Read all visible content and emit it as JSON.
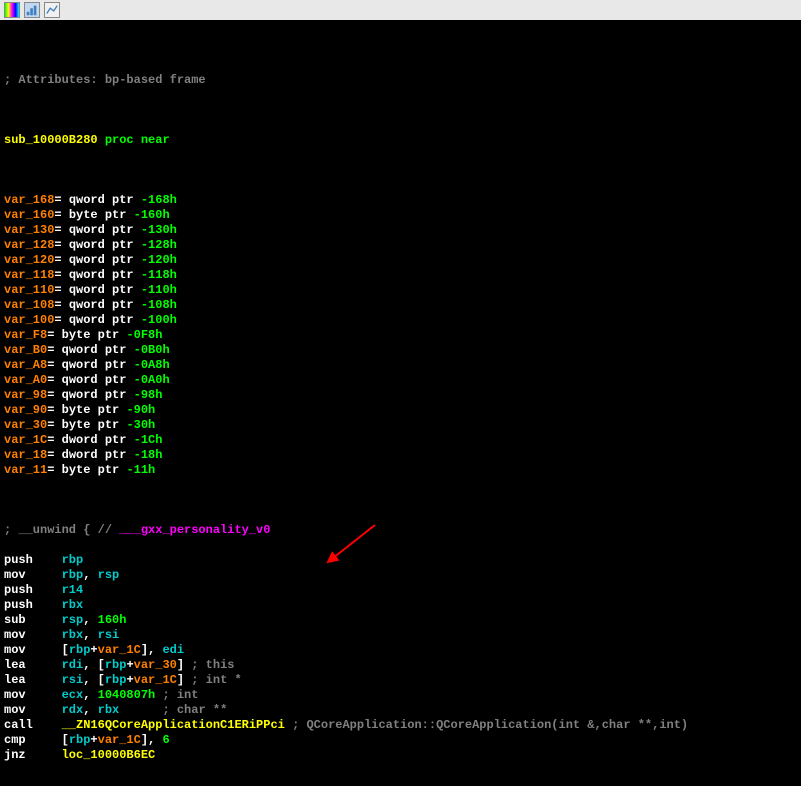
{
  "toolbar": {
    "icon1": "bars-icon",
    "icon2": "chart-icon",
    "icon3": "graph-icon"
  },
  "header": {
    "attributes_comment": "; Attributes: bp-based frame",
    "func_name": "sub_10000B280",
    "proc": "proc",
    "near": "near"
  },
  "vars": [
    {
      "name": "var_168",
      "eq": "=",
      "type": "qword ptr",
      "offset": "-168h"
    },
    {
      "name": "var_160",
      "eq": "=",
      "type": "byte ptr",
      "offset": "-160h"
    },
    {
      "name": "var_130",
      "eq": "=",
      "type": "qword ptr",
      "offset": "-130h"
    },
    {
      "name": "var_128",
      "eq": "=",
      "type": "qword ptr",
      "offset": "-128h"
    },
    {
      "name": "var_120",
      "eq": "=",
      "type": "qword ptr",
      "offset": "-120h"
    },
    {
      "name": "var_118",
      "eq": "=",
      "type": "qword ptr",
      "offset": "-118h"
    },
    {
      "name": "var_110",
      "eq": "=",
      "type": "qword ptr",
      "offset": "-110h"
    },
    {
      "name": "var_108",
      "eq": "=",
      "type": "qword ptr",
      "offset": "-108h"
    },
    {
      "name": "var_100",
      "eq": "=",
      "type": "qword ptr",
      "offset": "-100h"
    },
    {
      "name": "var_F8",
      "eq": "=",
      "type": "byte ptr",
      "offset": "-0F8h"
    },
    {
      "name": "var_B0",
      "eq": "=",
      "type": "qword ptr",
      "offset": "-0B0h"
    },
    {
      "name": "var_A8",
      "eq": "=",
      "type": "qword ptr",
      "offset": "-0A8h"
    },
    {
      "name": "var_A0",
      "eq": "=",
      "type": "qword ptr",
      "offset": "-0A0h"
    },
    {
      "name": "var_98",
      "eq": "=",
      "type": "qword ptr",
      "offset": "-98h"
    },
    {
      "name": "var_90",
      "eq": "=",
      "type": "byte ptr",
      "offset": "-90h"
    },
    {
      "name": "var_30",
      "eq": "=",
      "type": "byte ptr",
      "offset": "-30h"
    },
    {
      "name": "var_1C",
      "eq": "=",
      "type": "dword ptr",
      "offset": "-1Ch"
    },
    {
      "name": "var_18",
      "eq": "=",
      "type": "dword ptr",
      "offset": "-18h"
    },
    {
      "name": "var_11",
      "eq": "=",
      "type": "byte ptr",
      "offset": "-11h"
    }
  ],
  "unwind": {
    "prefix": "; __unwind { // ",
    "name": "___gxx_personality_v0"
  },
  "instructions": [
    {
      "mn": "push",
      "ops": [
        {
          "t": "reg",
          "v": "rbp"
        }
      ]
    },
    {
      "mn": "mov",
      "ops": [
        {
          "t": "reg",
          "v": "rbp"
        },
        {
          "t": "reg",
          "v": "rsp"
        }
      ]
    },
    {
      "mn": "push",
      "ops": [
        {
          "t": "reg",
          "v": "r14"
        }
      ]
    },
    {
      "mn": "push",
      "ops": [
        {
          "t": "reg",
          "v": "rbx"
        }
      ]
    },
    {
      "mn": "sub",
      "ops": [
        {
          "t": "reg",
          "v": "rsp"
        },
        {
          "t": "imm",
          "v": "160h"
        }
      ]
    },
    {
      "mn": "mov",
      "ops": [
        {
          "t": "reg",
          "v": "rbx"
        },
        {
          "t": "reg",
          "v": "rsi"
        }
      ]
    },
    {
      "mn": "mov",
      "ops": [
        {
          "t": "mem",
          "v": "[rbp+var_1C]"
        },
        {
          "t": "reg",
          "v": "edi"
        }
      ]
    },
    {
      "mn": "lea",
      "ops": [
        {
          "t": "reg",
          "v": "rdi"
        },
        {
          "t": "mem",
          "v": "[rbp+var_30]"
        }
      ],
      "comment": "; this"
    },
    {
      "mn": "lea",
      "ops": [
        {
          "t": "reg",
          "v": "rsi"
        },
        {
          "t": "mem",
          "v": "[rbp+var_1C]"
        }
      ],
      "comment": "; int *"
    },
    {
      "mn": "mov",
      "ops": [
        {
          "t": "reg",
          "v": "ecx"
        },
        {
          "t": "imm",
          "v": "1040807h"
        }
      ],
      "comment": "; int"
    },
    {
      "mn": "mov",
      "ops": [
        {
          "t": "reg",
          "v": "rdx"
        },
        {
          "t": "reg",
          "v": "rbx"
        }
      ],
      "comment": "; char **"
    },
    {
      "mn": "call",
      "ops": [
        {
          "t": "dem",
          "v": "__ZN16QCoreApplicationC1ERiPPci"
        }
      ],
      "comment": "; QCoreApplication::QCoreApplication(int &,char **,int)"
    },
    {
      "mn": "cmp",
      "ops": [
        {
          "t": "mem",
          "v": "[rbp+var_1C]"
        },
        {
          "t": "imm",
          "v": "6"
        }
      ]
    },
    {
      "mn": "jnz",
      "ops": [
        {
          "t": "loc",
          "v": "loc_10000B6EC"
        }
      ]
    }
  ]
}
